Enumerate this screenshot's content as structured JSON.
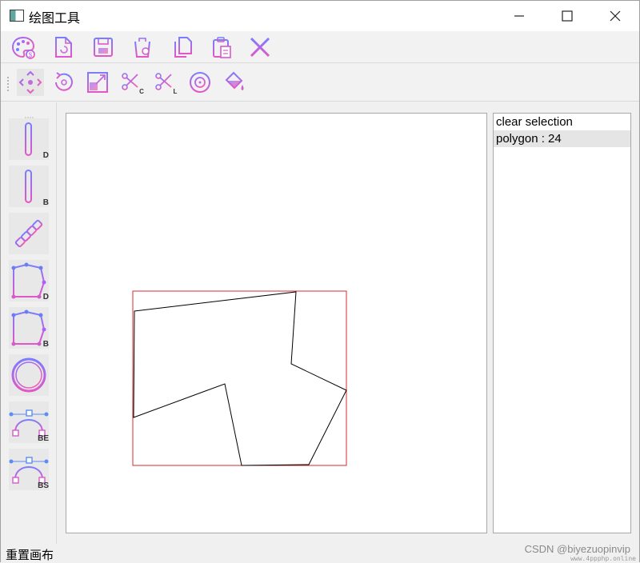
{
  "window": {
    "title": "绘图工具",
    "minimize_icon": "minimize-icon",
    "maximize_icon": "maximize-icon",
    "close_icon": "close-icon"
  },
  "toolbar_file": [
    {
      "name": "palette-icon"
    },
    {
      "name": "new-file-icon"
    },
    {
      "name": "save-icon"
    },
    {
      "name": "delete-icon"
    },
    {
      "name": "copy-icon"
    },
    {
      "name": "paste-icon"
    },
    {
      "name": "clear-icon"
    }
  ],
  "toolbar_transform": [
    {
      "name": "move-icon"
    },
    {
      "name": "rotate-icon"
    },
    {
      "name": "scale-icon"
    },
    {
      "name": "clip-cohen-icon",
      "sub": "C"
    },
    {
      "name": "clip-liang-icon",
      "sub": "L"
    },
    {
      "name": "ellipse-tool-icon"
    },
    {
      "name": "fill-bucket-icon"
    }
  ],
  "tools": [
    {
      "name": "line-dda-icon",
      "sub": "D"
    },
    {
      "name": "line-bresenham-icon",
      "sub": "B"
    },
    {
      "name": "pen-icon",
      "sub": ""
    },
    {
      "name": "polygon-dda-icon",
      "sub": "D"
    },
    {
      "name": "polygon-bresenham-icon",
      "sub": "B"
    },
    {
      "name": "circle-icon",
      "sub": ""
    },
    {
      "name": "curve-bezier-icon",
      "sub": "BE"
    },
    {
      "name": "curve-bspline-icon",
      "sub": "BS"
    }
  ],
  "list": {
    "items": [
      {
        "label": "clear selection",
        "selected": false
      },
      {
        "label": "polygon : 24",
        "selected": true
      }
    ]
  },
  "canvas": {
    "polygon_stroke": "#000000",
    "selection_stroke": "#d42c2c"
  },
  "status": {
    "text": "重置画布"
  },
  "watermark": {
    "main": "CSDN @biyezuopinvip",
    "sub": "www.4ppphp.online"
  },
  "colors": {
    "icon_gradient_start": "#a063ff",
    "icon_gradient_end": "#ff5ea8",
    "icon_blue": "#5b8df2"
  }
}
